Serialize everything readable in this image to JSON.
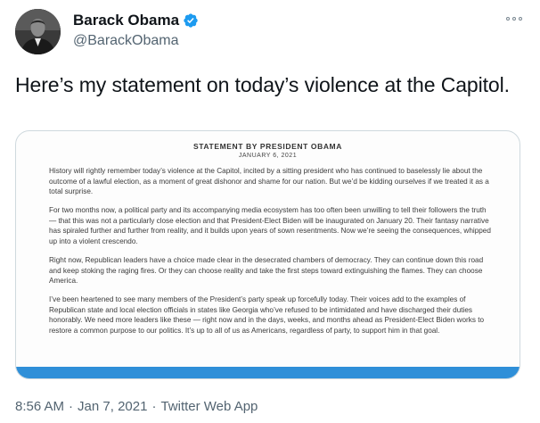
{
  "author": {
    "display_name": "Barack Obama",
    "handle": "@BarackObama",
    "verified_icon": "verified-badge-icon",
    "avatar_icon": "profile-photo",
    "verified_color": "#1d9bf0"
  },
  "more_icon": "more-options-icon",
  "tweet": {
    "text": "Here’s my statement on today’s violence at the Capitol."
  },
  "statement": {
    "title": "STATEMENT BY PRESIDENT OBAMA",
    "date": "JANUARY 6, 2021",
    "paragraphs": [
      "History will rightly remember today’s violence at the Capitol, incited by a sitting president who has continued to baselessly lie about the outcome of a lawful election, as a moment of great dishonor and shame for our nation. But we’d be kidding ourselves if we treated it as a total surprise.",
      "For two months now, a political party and its accompanying media ecosystem has too often been unwilling to tell their followers the truth — that this was not a particularly close election and that President-Elect Biden will be inaugurated on January 20. Their fantasy narrative has spiraled further and further from reality, and it builds upon years of sown resentments. Now we’re seeing the consequences, whipped up into a violent crescendo.",
      "Right now, Republican leaders have a choice made clear in the desecrated chambers of democracy. They can continue down this road and keep stoking the raging fires. Or they can choose reality and take the first steps toward extinguishing the flames. They can choose America.",
      "I’ve been heartened to see many members of the President’s party speak up forcefully today. Their voices add to the examples of Republican state and local election officials in states like Georgia who’ve refused to be intimidated and have discharged their duties honorably. We need more leaders like these — right now and in the days, weeks, and months ahead as President-Elect Biden works to restore a common purpose to our politics. It’s up to all of us as Americans, regardless of party, to support him in that goal."
    ],
    "band_color": "#2f8fd8"
  },
  "meta": {
    "time": "8:56 AM",
    "separator": "·",
    "date": "Jan 7, 2021",
    "source": "Twitter Web App"
  }
}
